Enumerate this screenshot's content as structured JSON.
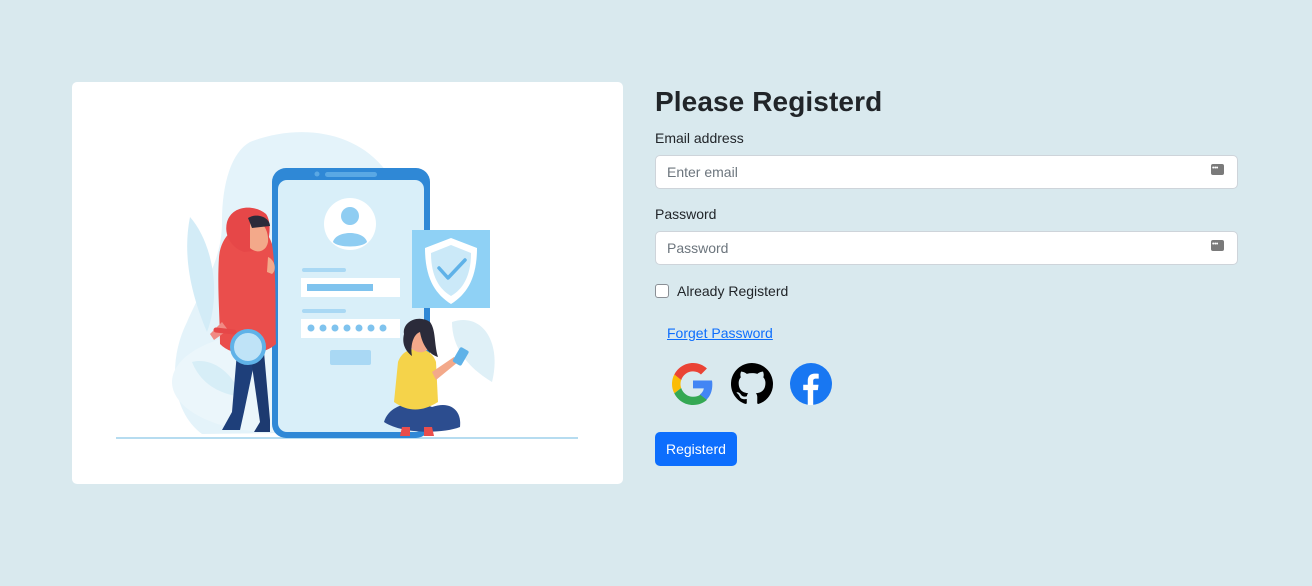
{
  "form": {
    "title": "Please Registerd",
    "email_label": "Email address",
    "email_placeholder": "Enter email",
    "email_value": "",
    "password_label": "Password",
    "password_placeholder": "Password",
    "password_value": "",
    "checkbox_label": "Already Registerd",
    "checkbox_checked": false,
    "forget_link": "Forget Password",
    "submit_label": "Registerd"
  },
  "social": [
    {
      "icon": "google-icon"
    },
    {
      "icon": "github-icon"
    },
    {
      "icon": "facebook-icon"
    }
  ],
  "colors": {
    "background": "#d9e9ee",
    "primary": "#0d6efd",
    "facebook": "#1877f2"
  }
}
